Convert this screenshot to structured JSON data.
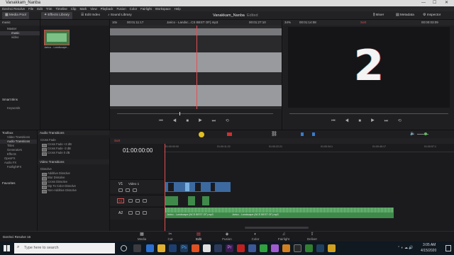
{
  "window": {
    "title": "Vanakkam_Nanba",
    "min": "—",
    "max": "☐",
    "close": "✕"
  },
  "menu": [
    "DaVinci Resolve",
    "File",
    "Edit",
    "Trim",
    "Timeline",
    "Clip",
    "Mark",
    "View",
    "Playback",
    "Fusion",
    "Color",
    "Fairlight",
    "Workspace",
    "Help"
  ],
  "toolbar": {
    "media_pool": "Media Pool",
    "effects_library": "Effects Library",
    "edit_index": "Edit Index",
    "sound_library": "Sound Library",
    "project_title": "Vanakkam_Nanba",
    "edited": "Edited",
    "mixer": "Mixer",
    "metadata": "Metadata",
    "inspector": "Inspector"
  },
  "media_pool": {
    "bin_label": "music",
    "tree": [
      "Master",
      "music",
      "video"
    ],
    "clip_name": "Jarico - Landscape...",
    "smart_bins": "Smart Bins",
    "keywords": "Keywords"
  },
  "source_viewer": {
    "zoom": "10x",
    "timecode_in": "00:01:11:17",
    "clip_title": "Jarico - Landsc...CS BEST OF).mp3",
    "timecode_out": "00:01:27:10"
  },
  "timeline_viewer": {
    "zoom": "34%",
    "timecode_in": "00:01:14:08",
    "timeline_name": "Sort",
    "timecode_out": "00:00:03:09",
    "digit": "2"
  },
  "effects": {
    "toolbox": "Toolbox",
    "video_transitions": "Video Transitions",
    "audio_transitions": "Audio Transitions",
    "titles": "Titles",
    "generators": "Generators",
    "effects": "Effects",
    "openfx": "OpenFX",
    "audio_fx": "Audio FX",
    "fairlight_fx": "FairlightFX",
    "favorites": "Favorites",
    "audio_trans_header": "Audio Transitions",
    "cross_fade": "Cross Fade",
    "cross_fade_items": [
      "Cross Fade +3 dB",
      "Cross Fade -3 dB",
      "Cross Fade 0 dB"
    ],
    "video_trans_header": "Video Transitions",
    "dissolve": "Dissolve",
    "dissolve_items": [
      "Additive Dissolve",
      "Blur Dissolve",
      "Cross Dissolve",
      "Dip To Color Dissolve",
      "Non-Additive Dissolve"
    ]
  },
  "timeline": {
    "tab": "Sort",
    "timecode": "01:00:00:00",
    "ruler": [
      "01:00:00:00",
      "01:00:11:22",
      "01:00:22:21",
      "01:00:34:1",
      "01:00:45:17",
      "01:00:57:1"
    ],
    "v1": "V1",
    "video1": "Video 1",
    "a1": "A1",
    "a2": "A2",
    "audio_clip_1": "Jarico - Landscape (NCS BEST OF).mp3",
    "audio_clip_2": "Jarico - Landscape (NCS BEST OF).mp3"
  },
  "pages": [
    {
      "label": "Media",
      "icon": "▦"
    },
    {
      "label": "Cut",
      "icon": "✂"
    },
    {
      "label": "Edit",
      "icon": "▤"
    },
    {
      "label": "Fusion",
      "icon": "◈"
    },
    {
      "label": "Color",
      "icon": "◐"
    },
    {
      "label": "Fairlight",
      "icon": "♫"
    },
    {
      "label": "Deliver",
      "icon": "⇪"
    }
  ],
  "app_name": "DaVinci Resolve 16",
  "taskbar": {
    "search": "Type here to search",
    "time": "3:05 AM",
    "date": "4/15/2020"
  },
  "colors": {
    "accent": "#e25050",
    "audio": "#3f8a4a",
    "video": "#4a7ab8"
  }
}
